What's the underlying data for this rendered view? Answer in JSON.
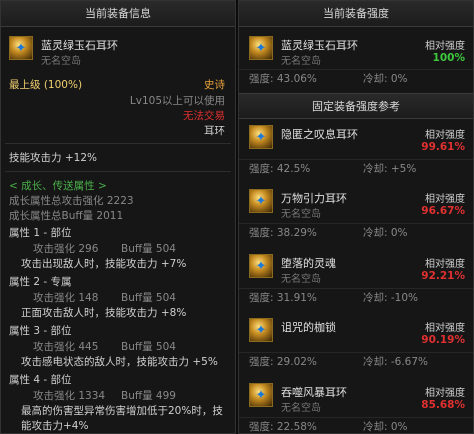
{
  "left": {
    "header": "当前装备信息",
    "item_name": "蓝灵绿玉石耳环",
    "item_sub": "无名空岛",
    "grade": "最上级 (100%)",
    "rarity": "史诗",
    "level_req": "Lv105以上可以使用",
    "trade": "无法交易",
    "type": "耳环",
    "skill_atk": "技能攻击力 +12%",
    "growth_title": "< 成长、传送属性 >",
    "growth_total": "成长属性总攻击强化 2223",
    "growth_buff": "成长属性总Buff量 2011",
    "attrs": [
      {
        "title": "属性 1 - 部位",
        "atk": "攻击强化 296",
        "buff": "Buff量 504",
        "desc": "攻击出现敌人时，技能攻击力 +7%"
      },
      {
        "title": "属性 2 - 专属",
        "atk": "攻击强化 148",
        "buff": "Buff量 504",
        "desc": "正面攻击敌人时，技能攻击力 +8%"
      },
      {
        "title": "属性 3 - 部位",
        "atk": "攻击强化 445",
        "buff": "Buff量 504",
        "desc": "攻击感电状态的敌人时，技能攻击力 +5%"
      },
      {
        "title": "属性 4 - 部位",
        "atk": "攻击强化 1334",
        "buff": "Buff量 499",
        "desc1": "最高的伤害型异常伤害增加低于20%时，技",
        "desc2": "能攻击力+4%"
      }
    ]
  },
  "right": {
    "header": "当前装备强度",
    "current": {
      "name": "蓝灵绿玉石耳环",
      "sub": "无名空岛",
      "label": "相对强度",
      "value": "100%",
      "strength": "强度: 43.06%",
      "cooldown": "冷却: 0%"
    },
    "ref_header": "固定装备强度参考",
    "refs": [
      {
        "name": "隐匿之叹息耳环",
        "sub": "",
        "label": "相对强度",
        "value": "99.61%",
        "strength": "强度: 42.5%",
        "cooldown": "冷却: +5%"
      },
      {
        "name": "万物引力耳环",
        "sub": "无名空岛",
        "label": "相对强度",
        "value": "96.67%",
        "strength": "强度: 38.29%",
        "cooldown": "冷却: 0%"
      },
      {
        "name": "堕落的灵魂",
        "sub": "无名空岛",
        "label": "相对强度",
        "value": "92.21%",
        "strength": "强度: 31.91%",
        "cooldown": "冷却: -10%"
      },
      {
        "name": "诅咒的枷锁",
        "sub": "",
        "label": "相对强度",
        "value": "90.19%",
        "strength": "强度: 29.02%",
        "cooldown": "冷却: -6.67%"
      },
      {
        "name": "吞噬风暴耳环",
        "sub": "无名空岛",
        "label": "相对强度",
        "value": "85.68%",
        "strength": "强度: 22.58%",
        "cooldown": "冷却: 0%"
      }
    ]
  },
  "colors": {
    "value_current": "#3ec83e",
    "value_ref": "#e03030",
    "epic": "#e8a03a"
  }
}
